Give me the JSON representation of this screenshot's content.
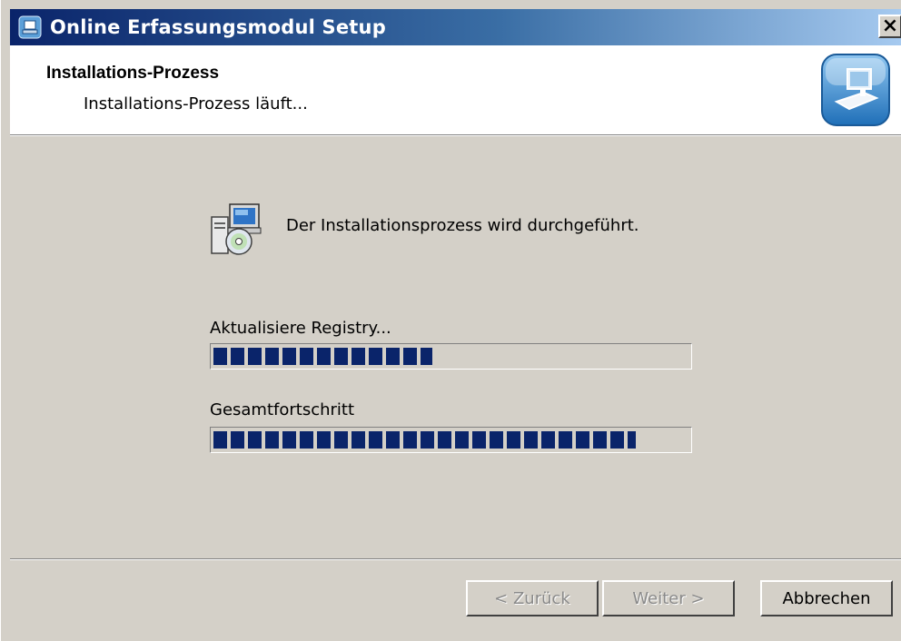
{
  "window": {
    "title": "Online Erfassungsmodul Setup",
    "close_label": "×"
  },
  "header": {
    "title": "Installations-Prozess",
    "subtitle": "Installations-Prozess läuft..."
  },
  "body": {
    "message": "Der Installationsprozess wird durchgeführt.",
    "status_label": "Aktualisiere Registry...",
    "status_progress_fraction": 0.46,
    "overall_label": "Gesamtfortschritt",
    "overall_progress_fraction": 0.89
  },
  "buttons": {
    "back_label": "< Zurück",
    "next_label": "Weiter >",
    "cancel_label": "Abbrechen"
  },
  "icons": {
    "title_icon": "setup-icon",
    "header_logo": "installer-logo-icon",
    "body_icon": "install-computer-cd-icon"
  },
  "colors": {
    "progress_fill": "#0a246a",
    "dialog_bg": "#d4d0c8",
    "title_gradient_start": "#0a246a",
    "title_gradient_end": "#a6caf0"
  }
}
